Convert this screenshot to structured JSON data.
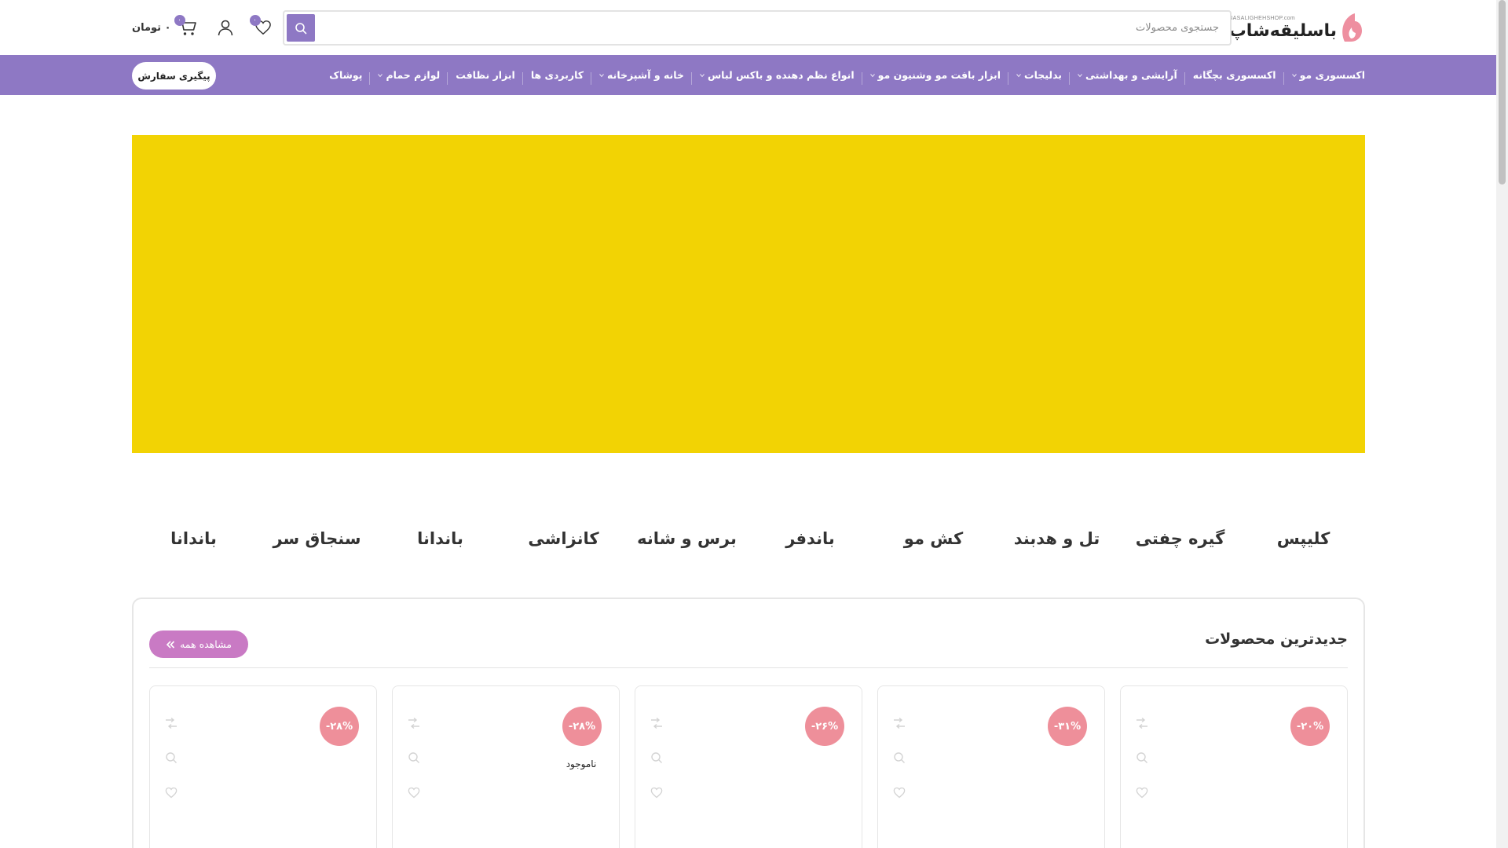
{
  "header": {
    "logo_en": "BASALIGHEHSHOP.com",
    "logo_fa": "باسلیقه‌شاپ",
    "search_placeholder": "جستجوی محصولات",
    "wishlist_count": "۰",
    "cart_count": "۰",
    "cart_amount": "۰ تومان"
  },
  "nav": {
    "items": [
      {
        "label": "اکسسوری مو",
        "has_sub": true
      },
      {
        "label": "اکسسوری بچگانه",
        "has_sub": false
      },
      {
        "label": "آرایشی و بهداشتی",
        "has_sub": true
      },
      {
        "label": "بدلیجات",
        "has_sub": true
      },
      {
        "label": "ابزار بافت مو وشنیون مو",
        "has_sub": true
      },
      {
        "label": "انواع نظم دهنده و باکس لباس",
        "has_sub": true
      },
      {
        "label": "خانه و آشپزخانه",
        "has_sub": true
      },
      {
        "label": "کاربردی ها",
        "has_sub": false
      },
      {
        "label": "ابزار نظافت",
        "has_sub": false
      },
      {
        "label": "لوازم حمام",
        "has_sub": true
      },
      {
        "label": "پوشاک",
        "has_sub": false
      }
    ],
    "track_order": "پیگیری سفارش"
  },
  "categories": [
    "کلیپس",
    "گیره چفتی",
    "تل و هدبند",
    "کش مو",
    "باندفر",
    "برس و شانه",
    "کانزاشی",
    "باندانا",
    "سنجاق سر",
    "باندانا"
  ],
  "newest": {
    "title": "جدیدترین محصولات",
    "see_all": "مشاهده همه",
    "cards": [
      {
        "discount": "-۲۰%",
        "status": ""
      },
      {
        "discount": "-۳۱%",
        "status": ""
      },
      {
        "discount": "-۲۶%",
        "status": ""
      },
      {
        "discount": "-۲۸%",
        "status": "ناموجود"
      },
      {
        "discount": "-۲۸%",
        "status": ""
      }
    ]
  },
  "colors": {
    "primary": "#8e78c4",
    "banner": "#f2d304",
    "discount": "#ee8f9a",
    "see_all": "#c97ac4"
  }
}
